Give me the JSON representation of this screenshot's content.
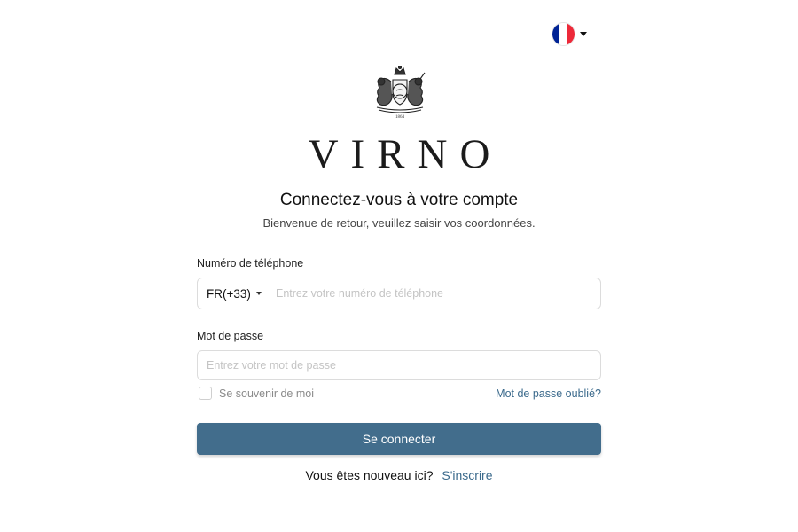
{
  "language": {
    "flag_icon": "france-flag-icon",
    "flag_colors": [
      "#002395",
      "#ffffff",
      "#ed2939"
    ]
  },
  "logo": {
    "crest_icon": "royal-crest-icon",
    "crest_year": "1864",
    "brand": "VIRNO"
  },
  "heading": {
    "title": "Connectez-vous à votre compte",
    "subtitle": "Bienvenue de retour, veuillez saisir vos coordonnées."
  },
  "phone": {
    "label": "Numéro de téléphone",
    "country_code": "FR(+33)",
    "placeholder": "Entrez votre numéro de téléphone",
    "value": ""
  },
  "password": {
    "label": "Mot de passe",
    "placeholder": "Entrez votre mot de passe",
    "value": ""
  },
  "remember": {
    "label": "Se souvenir de moi",
    "checked": false
  },
  "forgot_link": "Mot de passe oublié?",
  "submit_label": "Se connecter",
  "signup": {
    "prompt": "Vous êtes nouveau ici?",
    "link": "S'inscrire"
  },
  "colors": {
    "primary": "#426d8c",
    "link": "#3b6a8c"
  }
}
